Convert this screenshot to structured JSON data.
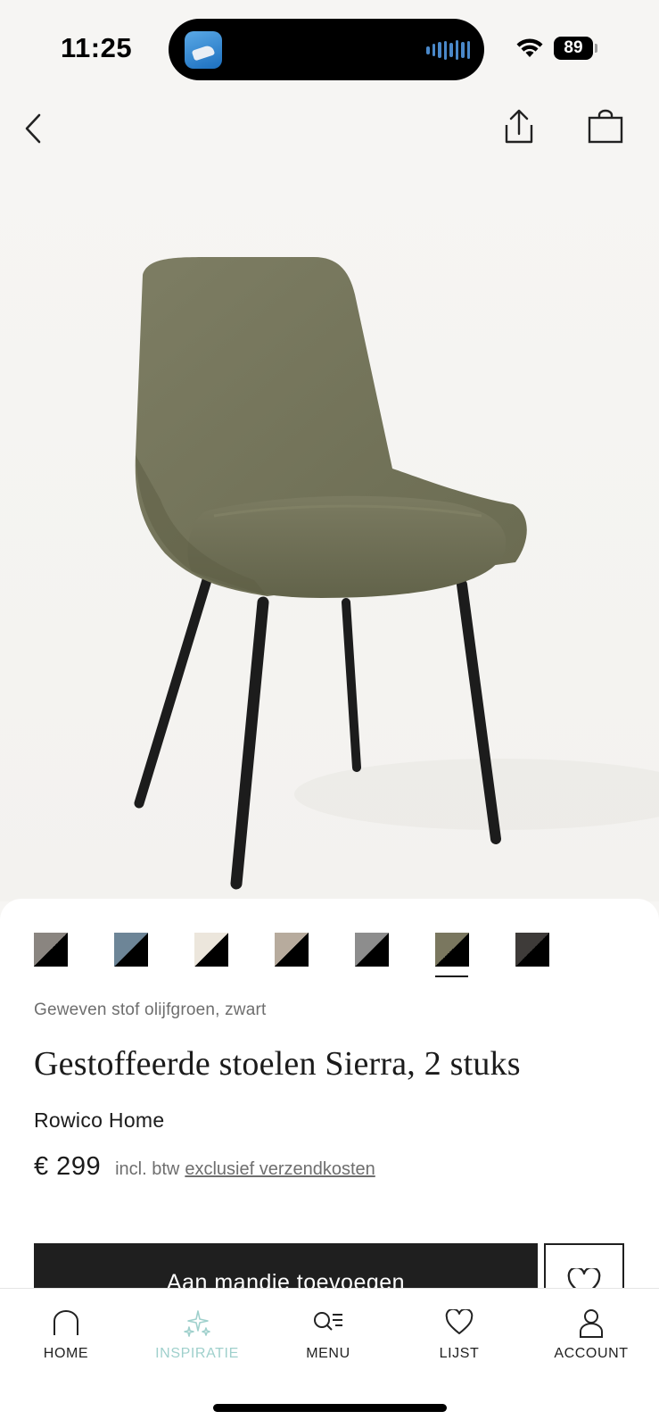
{
  "status_bar": {
    "time": "11:25",
    "battery": "89",
    "island_app_icon": "app-thumbnail-icon",
    "wifi_icon": "wifi-icon"
  },
  "nav": {
    "back_icon": "chevron-left-icon",
    "share_icon": "share-icon",
    "bag_icon": "shopping-bag-icon"
  },
  "product": {
    "image": "green-upholstered-dining-chair",
    "swatches": [
      {
        "name": "taupe",
        "color": "#8a8580"
      },
      {
        "name": "blue-grey",
        "color": "#6d8597"
      },
      {
        "name": "cream",
        "color": "#ece6dc"
      },
      {
        "name": "beige",
        "color": "#b7ab9d"
      },
      {
        "name": "grey",
        "color": "#8d8d8d"
      },
      {
        "name": "olive",
        "color": "#7a775f",
        "selected": true
      },
      {
        "name": "dark-grey",
        "color": "#3e3b39"
      }
    ],
    "variant": "Geweven stof olijfgroen, zwart",
    "title": "Gestoffeerde stoelen Sierra, 2 stuks",
    "brand": "Rowico Home",
    "price": "€ 299",
    "tax_note": "incl. btw",
    "shipping_link": "exclusief verzendkosten",
    "add_to_cart": "Aan mandje toevoegen"
  },
  "tab_bar": {
    "tabs": [
      {
        "label": "HOME",
        "icon": "home-icon",
        "active": false
      },
      {
        "label": "INSPIRATIE",
        "icon": "sparkles-icon",
        "active": true
      },
      {
        "label": "MENU",
        "icon": "search-menu-icon",
        "active": false
      },
      {
        "label": "LIJST",
        "icon": "heart-icon",
        "active": false
      },
      {
        "label": "ACCOUNT",
        "icon": "user-icon",
        "active": false
      }
    ],
    "active_color": "#9fd0cc"
  }
}
